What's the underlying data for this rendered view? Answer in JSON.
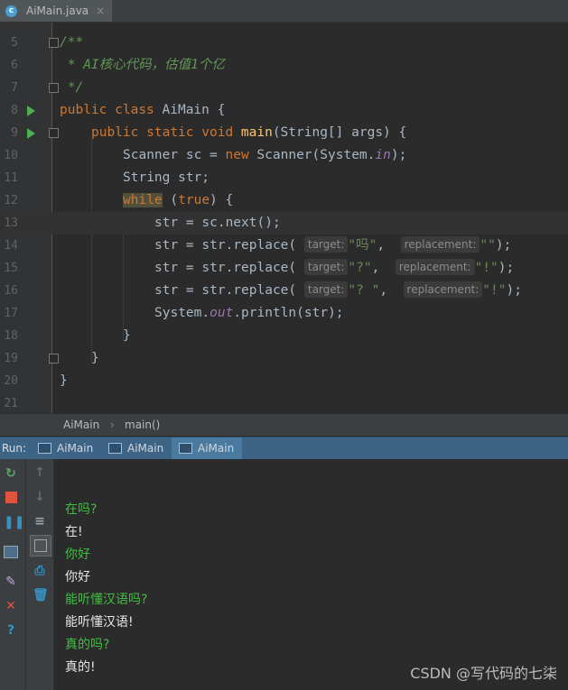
{
  "tab": {
    "icon": "java-class-icon",
    "title": "AiMain.java",
    "close": "×"
  },
  "editor": {
    "lines": [
      {
        "num": "5"
      },
      {
        "num": "6"
      },
      {
        "num": "7"
      },
      {
        "num": "8"
      },
      {
        "num": "9"
      },
      {
        "num": "10"
      },
      {
        "num": "11"
      },
      {
        "num": "12"
      },
      {
        "num": "13"
      },
      {
        "num": "14"
      },
      {
        "num": "15"
      },
      {
        "num": "16"
      },
      {
        "num": "17"
      },
      {
        "num": "18"
      },
      {
        "num": "19"
      },
      {
        "num": "20"
      },
      {
        "num": "21"
      }
    ],
    "code": {
      "l5": "/**",
      "l6": " * AI核心代码，估值1个亿",
      "l7": " */",
      "l8_kw1": "public",
      "l8_kw2": "class",
      "l8_rest": " AiMain {",
      "l9_kw1": "public",
      "l9_kw2": "static",
      "l9_kw3": "void",
      "l9_fn": "main",
      "l9_rest": "(String[] args) {",
      "l10_a": "Scanner sc = ",
      "l10_kw": "new",
      "l10_b": " Scanner(System.",
      "l10_fld": "in",
      "l10_c": ");",
      "l11": "String str;",
      "l12_kw": "while",
      "l12_a": " (",
      "l12_kw2": "true",
      "l12_b": ") {",
      "l13": "str = sc.next();",
      "l14_a": "str = str.replace( ",
      "l14_h1": "target:",
      "l14_s1": "\"吗\"",
      "l14_h2": "replacement:",
      "l14_s2": "\"\"",
      "l14_b": ");",
      "l15_a": "str = str.replace( ",
      "l15_h1": "target:",
      "l15_s1": "\"?\"",
      "l15_h2": "replacement:",
      "l15_s2": "\"!\"",
      "l15_b": ");",
      "l16_a": "str = str.replace( ",
      "l16_h1": "target:",
      "l16_s1": "\"? \"",
      "l16_h2": "replacement:",
      "l16_s2": "\"!\"",
      "l16_b": ");",
      "l17_a": "System.",
      "l17_fld": "out",
      "l17_b": ".println(str);",
      "l18": "}",
      "l19": "}",
      "l20": "}"
    }
  },
  "breadcrumb": {
    "class": "AiMain",
    "sep": "›",
    "method": "main()"
  },
  "run": {
    "label": "Run:",
    "tabs": [
      {
        "label": "AiMain"
      },
      {
        "label": "AiMain"
      },
      {
        "label": "AiMain"
      }
    ]
  },
  "console": {
    "lines": [
      {
        "text": "在吗?",
        "kind": "input"
      },
      {
        "text": "在!",
        "kind": "output"
      },
      {
        "text": "你好",
        "kind": "input"
      },
      {
        "text": "你好",
        "kind": "output"
      },
      {
        "text": "能听懂汉语吗?",
        "kind": "input"
      },
      {
        "text": "能听懂汉语!",
        "kind": "output"
      },
      {
        "text": "真的吗?",
        "kind": "input"
      },
      {
        "text": "真的!",
        "kind": "output"
      }
    ]
  },
  "watermark": "CSDN @写代码的七柒"
}
